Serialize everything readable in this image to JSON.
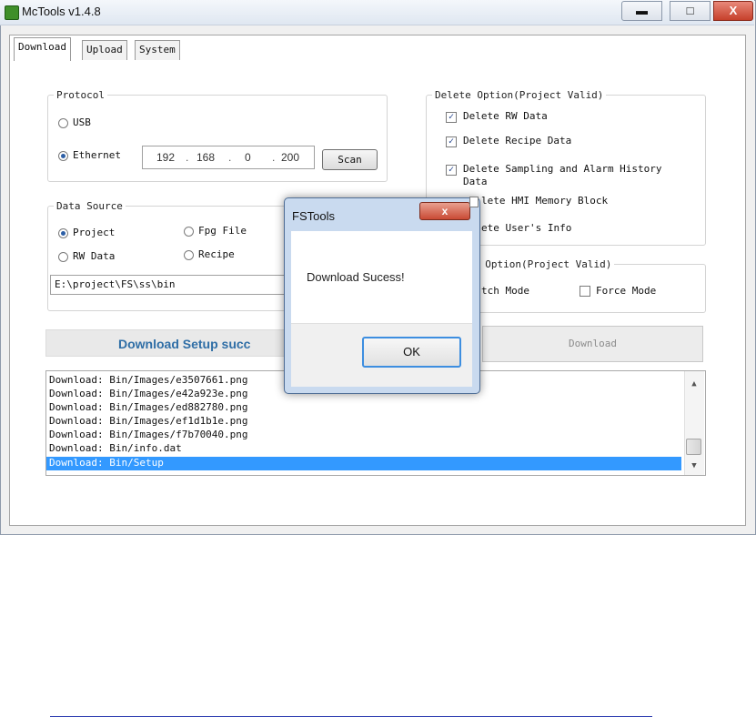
{
  "window": {
    "title": "McTools v1.4.8",
    "min_glyph": "▬",
    "max_glyph": "□",
    "close_glyph": "X"
  },
  "tabs": [
    {
      "label": "Download",
      "active": true
    },
    {
      "label": "Upload",
      "active": false
    },
    {
      "label": "System",
      "active": false
    }
  ],
  "protocol": {
    "legend": "Protocol",
    "usb_label": "USB",
    "ethernet_label": "Ethernet",
    "selected": "Ethernet",
    "ip": [
      "192",
      "168",
      "0",
      "200"
    ],
    "scan_label": "Scan"
  },
  "data_source": {
    "legend": "Data Source",
    "project_label": "Project",
    "fpg_label": "Fpg File",
    "rw_label": "RW Data",
    "recipe_label": "Recipe",
    "selected": "Project",
    "path": "E:\\project\\FS\\ss\\bin"
  },
  "delete_option": {
    "legend": "Delete Option(Project Valid)",
    "items": [
      {
        "label": "Delete RW Data",
        "checked": true
      },
      {
        "label": "Delete Recipe Data",
        "checked": true
      },
      {
        "label": "Delete Sampling and Alarm History",
        "label2": "Data",
        "checked": true
      },
      {
        "label": "lete HMI Memory Block",
        "checked": true
      },
      {
        "label": "ete User's Info",
        "checked": false
      }
    ]
  },
  "download_option": {
    "legend": "d Option(Project Valid)",
    "batch_label": "tch Mode",
    "force_label": "Force Mode",
    "force_checked": false
  },
  "status": {
    "text": "Download Setup succ"
  },
  "download_button": "Download",
  "log": [
    "Download: Bin/Images/e3507661.png",
    "Download: Bin/Images/e42a923e.png",
    "Download: Bin/Images/ed882780.png",
    "Download: Bin/Images/ef1d1b1e.png",
    "Download: Bin/Images/f7b70040.png",
    "Download: Bin/info.dat",
    "Download: Bin/Setup"
  ],
  "dialog": {
    "title": "FSTools",
    "close_glyph": "x",
    "message": "Download Sucess!",
    "ok_label": "OK"
  },
  "colors": {
    "selection": "#3399ff",
    "status_text": "#2f6ea6",
    "close_red": "#c6402b"
  }
}
